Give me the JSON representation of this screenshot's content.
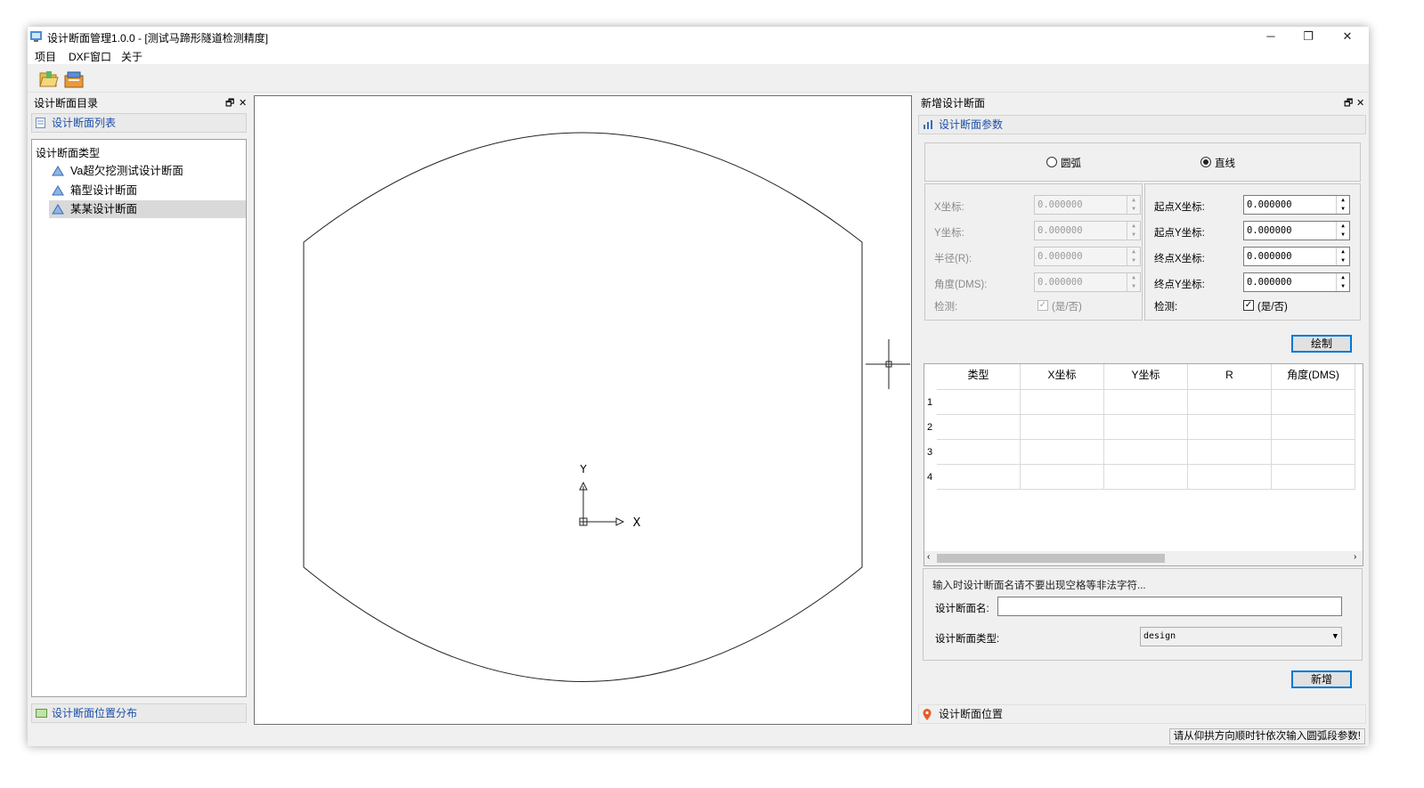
{
  "window": {
    "title": "设计断面管理1.0.0 - [测试马蹄形隧道检测精度]",
    "minimize": "─",
    "restore": "❐",
    "close": "✕"
  },
  "menu": [
    "项目",
    "DXF窗口",
    "关于"
  ],
  "left_panel": {
    "title": "设计断面目录",
    "group_title": "设计断面列表",
    "tree_root": "设计断面类型",
    "tree_items": [
      "Va超欠挖测试设计断面",
      "箱型设计断面",
      "某某设计断面"
    ],
    "selected_index": 2,
    "bottom_group": "设计断面位置分布"
  },
  "canvas": {
    "axis_y": "Y",
    "axis_x": "X"
  },
  "right_panel": {
    "title": "新增设计断面",
    "params_group": "设计断面参数",
    "radio_arc": "圆弧",
    "radio_line": "直线",
    "selected_mode": "直线",
    "arc_fields": [
      {
        "label": "X坐标:",
        "value": "0.000000"
      },
      {
        "label": "Y坐标:",
        "value": "0.000000"
      },
      {
        "label": "半径(R):",
        "value": "0.000000"
      },
      {
        "label": "角度(DMS):",
        "value": "0.000000"
      }
    ],
    "arc_check_label": "检测:",
    "arc_check_text": "(是/否)",
    "line_fields": [
      {
        "label": "起点X坐标:",
        "value": "0.000000"
      },
      {
        "label": "起点Y坐标:",
        "value": "0.000000"
      },
      {
        "label": "终点X坐标:",
        "value": "0.000000"
      },
      {
        "label": "终点Y坐标:",
        "value": "0.000000"
      }
    ],
    "line_check_label": "检测:",
    "line_check_text": "(是/否)",
    "draw_button": "绘制",
    "table": {
      "columns": [
        "类型",
        "X坐标",
        "Y坐标",
        "R",
        "角度(DMS)"
      ],
      "rows": [
        "1",
        "2",
        "3",
        "4"
      ]
    },
    "hint": "输入时设计断面名请不要出现空格等非法字符...",
    "name_label": "设计断面名:",
    "name_value": "",
    "type_label": "设计断面类型:",
    "type_value": "design",
    "add_button": "新增",
    "bottom_group": "设计断面位置"
  },
  "status": "请从仰拱方向顺时针依次输入圆弧段参数!"
}
